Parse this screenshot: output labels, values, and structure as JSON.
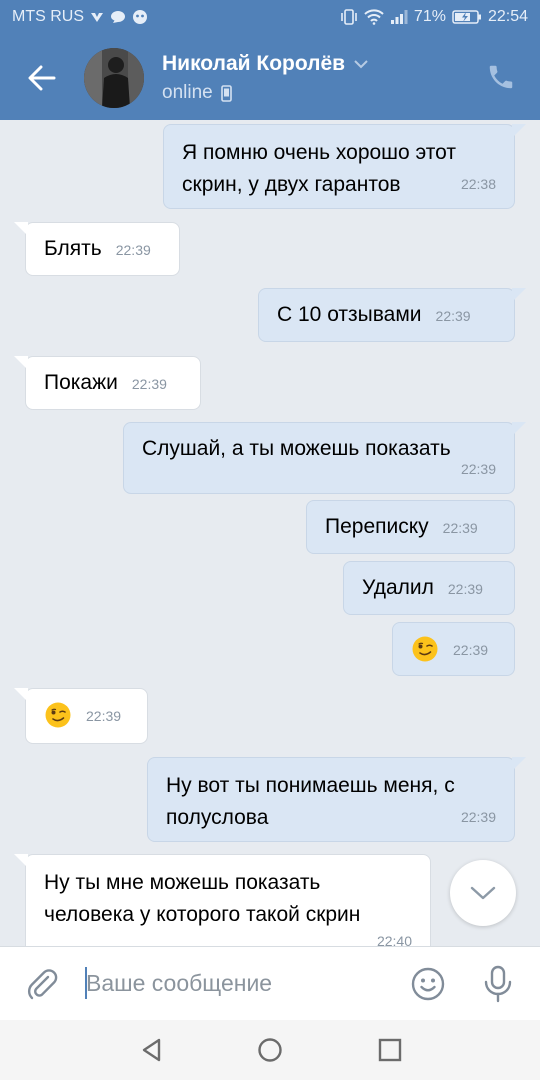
{
  "status_bar": {
    "carrier": "MTS RUS",
    "battery": "71%",
    "time": "22:54"
  },
  "header": {
    "contact_name": "Николай Королёв",
    "contact_status": "online"
  },
  "messages": [
    {
      "dir": "out",
      "lines": [
        "Я помню очень хорошо этот",
        "скрин, у двух гарантов"
      ],
      "time": "22:38"
    },
    {
      "dir": "in",
      "text": "Блять",
      "time": "22:39"
    },
    {
      "dir": "out",
      "text": "С 10 отзывами",
      "time": "22:39"
    },
    {
      "dir": "in",
      "text": "Покажи",
      "time": "22:39"
    },
    {
      "dir": "out",
      "text": "Слушай, а ты можешь показать",
      "time": "22:39"
    },
    {
      "dir": "out",
      "text": "Переписку",
      "time": "22:39"
    },
    {
      "dir": "out",
      "text": "Удалил",
      "time": "22:39"
    },
    {
      "dir": "out",
      "emoji": "winking-face",
      "time": "22:39"
    },
    {
      "dir": "in",
      "emoji": "winking-face",
      "time": "22:39"
    },
    {
      "dir": "out",
      "lines": [
        "Ну вот ты понимаешь меня, с",
        "полуслова"
      ],
      "time": "22:39"
    },
    {
      "dir": "in",
      "lines": [
        "Ну ты мне можешь показать",
        "человека у которого такой скрин"
      ],
      "time": "22:40"
    }
  ],
  "composer": {
    "placeholder": "Ваше сообщение"
  },
  "colors": {
    "header": "#5181b8",
    "outgoing_bubble": "#dae6f4",
    "incoming_bubble": "#ffffff",
    "background": "#e7ebf0"
  }
}
